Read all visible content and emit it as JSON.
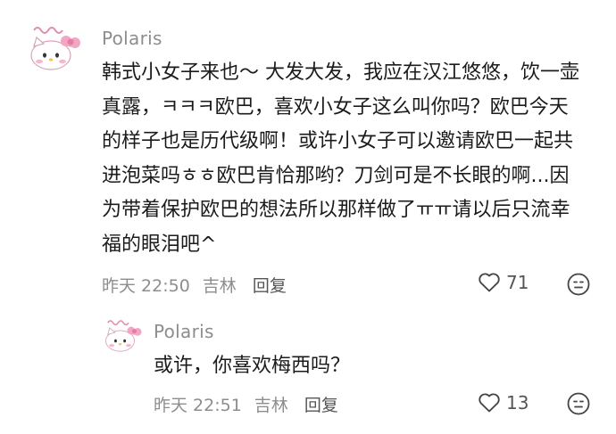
{
  "comment": {
    "username": "Polaris",
    "text": "韩式小女子来也～ 大发大发，我应在汉江悠悠，饮一壶真露，ㅋㅋㅋ欧巴，喜欢小女子这么叫你吗？欧巴今天的样子也是历代级啊！或许小女子可以邀请欧巴一起共进泡菜吗ㅎㅎ欧巴肯恰那哟？刀剑可是不长眼的啊...因为带着保护欧巴的想法所以那样做了ㅠㅠ请以后只流幸福的眼泪吧^",
    "time": "昨天 22:50",
    "location": "吉林",
    "reply_label": "回复",
    "likes": "71"
  },
  "reply": {
    "username": "Polaris",
    "text": "或许，你喜欢梅西吗？",
    "time": "昨天 22:51",
    "location": "吉林",
    "reply_label": "回复",
    "likes": "13"
  },
  "colors": {
    "meta": "#8d8d8d",
    "text": "#1b1b1b",
    "avatar_bow": "#f2a6c3"
  },
  "icons": {
    "like": "heart-outline-icon",
    "react": "emoji-face-icon",
    "avatar": "hello-kitty-avatar"
  }
}
